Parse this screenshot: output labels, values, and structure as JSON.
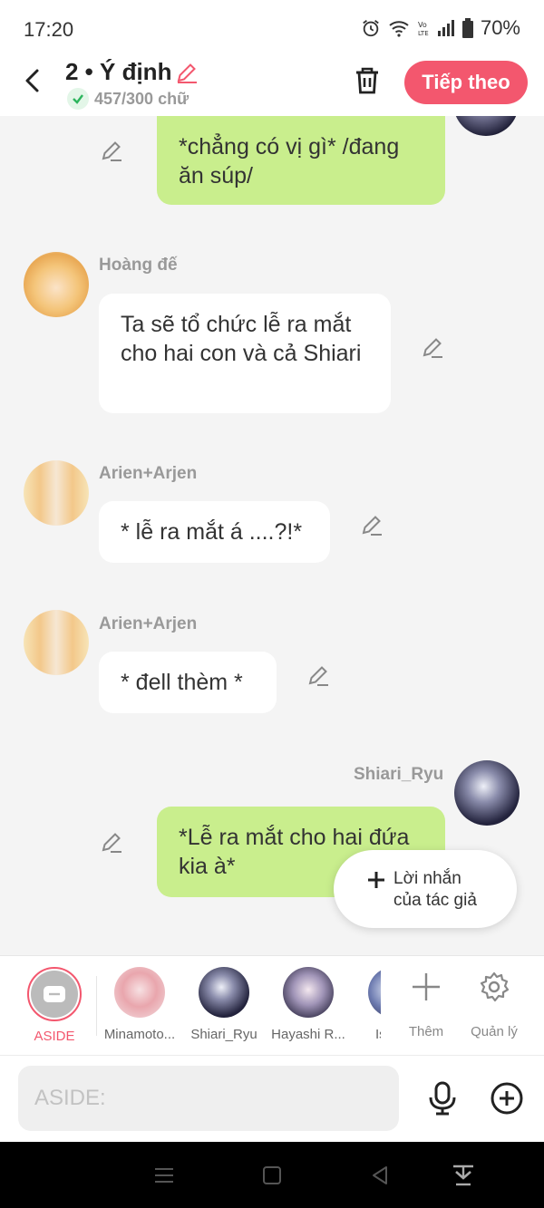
{
  "status": {
    "time": "17:20",
    "battery": "70%"
  },
  "header": {
    "title": "2 • Ý định",
    "word_count": "457/300 chữ",
    "next_label": "Tiếp theo"
  },
  "messages": [
    {
      "side": "right",
      "name": "",
      "text": "*chẳng có vị gì* /đang ăn súp/"
    },
    {
      "side": "left",
      "name": "Hoàng đế",
      "text": "Ta sẽ tổ chức lễ ra mắt cho hai con và cả Shiari"
    },
    {
      "side": "left",
      "name": "Arien+Arjen",
      "text": "* lễ ra mắt á ....?!*"
    },
    {
      "side": "left",
      "name": "Arien+Arjen",
      "text": "* đell thèm *"
    },
    {
      "side": "right",
      "name": "Shiari_Ryu",
      "text": "*Lễ ra mắt cho hai đứa kia à*"
    }
  ],
  "popup": {
    "label": "Lời nhắn của tác giả"
  },
  "characters": [
    {
      "label": "ASIDE"
    },
    {
      "label": "Minamoto..."
    },
    {
      "label": "Shiari_Ryu"
    },
    {
      "label": "Hayashi R..."
    },
    {
      "label": "Is"
    }
  ],
  "tools": {
    "more": "Thêm",
    "manage": "Quản lý"
  },
  "input": {
    "placeholder": "ASIDE:"
  },
  "colors": {
    "accent": "#f3576e",
    "green_bubble": "#c9ee8d"
  }
}
